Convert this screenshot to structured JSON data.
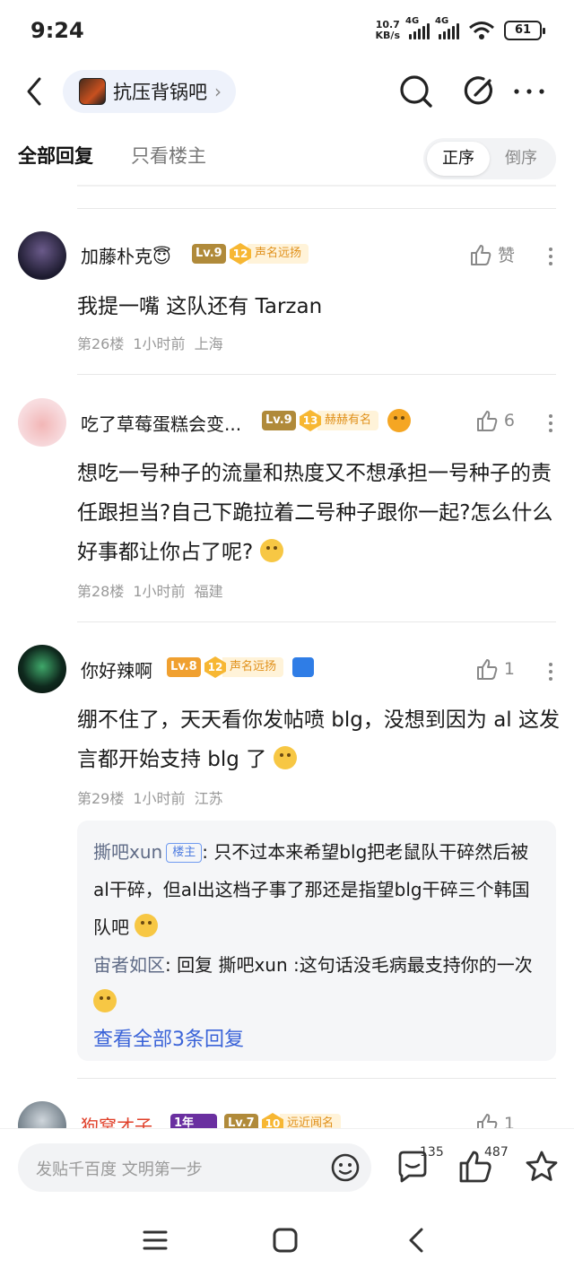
{
  "status_bar": {
    "time": "9:24",
    "net_speed_value": "10.7",
    "net_speed_unit": "KB/s",
    "signal1": "4G",
    "signal2": "4G",
    "battery": "61"
  },
  "nav": {
    "forum_name": "抗压背锅吧",
    "icons": [
      "back-icon",
      "search-icon",
      "edit-icon",
      "more-icon"
    ]
  },
  "tabs": {
    "all": "全部回复",
    "owner_only": "只看楼主",
    "sort_asc": "正序",
    "sort_desc": "倒序"
  },
  "posts": [
    {
      "username": "加藤朴克😇",
      "level": "Lv.9",
      "honor_level": "12",
      "honor_title": "声名远扬",
      "like_label": "赞",
      "text": "我提一嘴 这队还有 Tarzan",
      "floor": "第26楼",
      "time": "1小时前",
      "location": "上海"
    },
    {
      "username": "吃了草莓蛋糕会变...",
      "level": "Lv.9",
      "honor_level": "13",
      "honor_title": "赫赫有名",
      "likes": "6",
      "text": "想吃一号种子的流量和热度又不想承担一号种子的责任跟担当?自己下跪拉着二号种子跟你一起?怎么什么好事都让你占了呢?",
      "floor": "第28楼",
      "time": "1小时前",
      "location": "福建"
    },
    {
      "username": "你好辣啊",
      "level": "Lv.8",
      "honor_level": "12",
      "honor_title": "声名远扬",
      "likes": "1",
      "text": "绷不住了，天天看你发帖喷 blg，没想到因为 al 这发言都开始支持 blg 了",
      "floor": "第29楼",
      "time": "1小时前",
      "location": "江苏",
      "replies": [
        {
          "name": "撕吧xun",
          "badge": "楼主",
          "text": "只不过本来希望blg把老鼠队干碎然后被al干碎，但al出这档子事了那还是指望blg干碎三个韩国队吧"
        },
        {
          "name": "宙者如区",
          "text": "回复 撕吧xun :这句话没毛病最支持你的一次"
        }
      ],
      "see_all": "查看全部3条回复"
    },
    {
      "username": "狗窝才子",
      "years": "1年",
      "level": "Lv.7",
      "honor_level": "10",
      "honor_title": "远近闻名",
      "likes": "1"
    }
  ],
  "bottom_bar": {
    "placeholder": "发贴千百度 文明第一步",
    "comment_count": "135",
    "like_count": "487"
  }
}
